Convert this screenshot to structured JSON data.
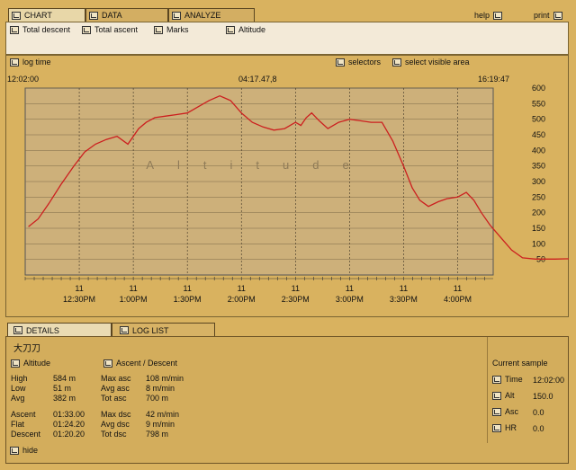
{
  "tabs": [
    {
      "label": "CHART",
      "icon": "chart-icon"
    },
    {
      "label": "DATA",
      "icon": "data-icon"
    },
    {
      "label": "ANALYZE",
      "icon": "analyze-icon"
    }
  ],
  "help_label": "help",
  "print_label": "print",
  "toolbar": {
    "total_descent": "Total descent",
    "total_ascent": "Total ascent",
    "marks": "Marks",
    "altitude": "Altitude"
  },
  "chart_controls": {
    "log_time": "log time",
    "selectors": "selectors",
    "select_visible_area": "select visible area"
  },
  "chart_header": {
    "start": "12:02:00",
    "center": "04:17.47,8",
    "end": "16:19:47"
  },
  "chart_data": {
    "type": "line",
    "watermark": "Altitude",
    "ylim": [
      0,
      600
    ],
    "yticks": [
      50,
      100,
      150,
      200,
      250,
      300,
      350,
      400,
      450,
      500,
      550,
      600
    ],
    "xticks": [
      {
        "day": "11",
        "time": "12:30PM"
      },
      {
        "day": "11",
        "time": "1:00PM"
      },
      {
        "day": "11",
        "time": "1:30PM"
      },
      {
        "day": "11",
        "time": "2:00PM"
      },
      {
        "day": "11",
        "time": "2:30PM"
      },
      {
        "day": "11",
        "time": "3:00PM"
      },
      {
        "day": "11",
        "time": "3:30PM"
      },
      {
        "day": "11",
        "time": "4:00PM"
      }
    ],
    "series": [
      {
        "color": "#cc1f1f",
        "points": [
          [
            12.03,
            155
          ],
          [
            12.12,
            180
          ],
          [
            12.22,
            230
          ],
          [
            12.33,
            290
          ],
          [
            12.45,
            350
          ],
          [
            12.55,
            395
          ],
          [
            12.65,
            420
          ],
          [
            12.75,
            435
          ],
          [
            12.85,
            445
          ],
          [
            12.95,
            420
          ],
          [
            13.05,
            470
          ],
          [
            13.12,
            490
          ],
          [
            13.2,
            505
          ],
          [
            13.3,
            510
          ],
          [
            13.4,
            515
          ],
          [
            13.5,
            520
          ],
          [
            13.6,
            540
          ],
          [
            13.7,
            560
          ],
          [
            13.8,
            575
          ],
          [
            13.9,
            560
          ],
          [
            14.0,
            520
          ],
          [
            14.1,
            490
          ],
          [
            14.2,
            475
          ],
          [
            14.3,
            465
          ],
          [
            14.4,
            470
          ],
          [
            14.5,
            490
          ],
          [
            14.55,
            480
          ],
          [
            14.6,
            505
          ],
          [
            14.65,
            520
          ],
          [
            14.72,
            495
          ],
          [
            14.8,
            470
          ],
          [
            14.9,
            490
          ],
          [
            15.0,
            500
          ],
          [
            15.1,
            495
          ],
          [
            15.2,
            490
          ],
          [
            15.3,
            490
          ],
          [
            15.4,
            430
          ],
          [
            15.5,
            350
          ],
          [
            15.58,
            280
          ],
          [
            15.65,
            240
          ],
          [
            15.73,
            220
          ],
          [
            15.82,
            235
          ],
          [
            15.9,
            245
          ],
          [
            16.0,
            250
          ],
          [
            16.08,
            265
          ],
          [
            16.15,
            240
          ],
          [
            16.22,
            200
          ],
          [
            16.3,
            160
          ],
          [
            16.4,
            120
          ],
          [
            16.5,
            80
          ],
          [
            16.6,
            55
          ],
          [
            16.72,
            51
          ],
          [
            16.9,
            51
          ],
          [
            17.0,
            52
          ],
          [
            17.08,
            52
          ]
        ]
      }
    ]
  },
  "details": {
    "tab_details": "DETAILS",
    "tab_log": "LOG LIST",
    "name": "大刀刀",
    "altitude_section": "Altitude",
    "ascent_section": "Ascent / Descent",
    "high_label": "High",
    "high_value": "584 m",
    "low_label": "Low",
    "low_value": "51 m",
    "avg_label": "Avg",
    "avg_value": "382 m",
    "ascent_label": "Ascent",
    "ascent_value": "01:33.00",
    "flat_label": "Flat",
    "flat_value": "01:24.20",
    "descent_label": "Descent",
    "descent_value": "01:20.20",
    "maxasc_label": "Max asc",
    "maxasc_value": "108 m/min",
    "avgasc_label": "Avg asc",
    "avgasc_value": "8 m/min",
    "totasc_label": "Tot asc",
    "totasc_value": "700 m",
    "maxdsc_label": "Max dsc",
    "maxdsc_value": "42 m/min",
    "avgdsc_label": "Avg dsc",
    "avgdsc_value": "9 m/min",
    "totdsc_label": "Tot dsc",
    "totdsc_value": "798 m",
    "current_sample": "Current sample",
    "time_label": "Time",
    "time_value": "12:02:00",
    "alt_label": "Alt",
    "alt_value": "150.0",
    "asc_label": "Asc",
    "asc_value": "0.0",
    "hr_label": "HR",
    "hr_value": "0.0",
    "hide": "hide"
  }
}
